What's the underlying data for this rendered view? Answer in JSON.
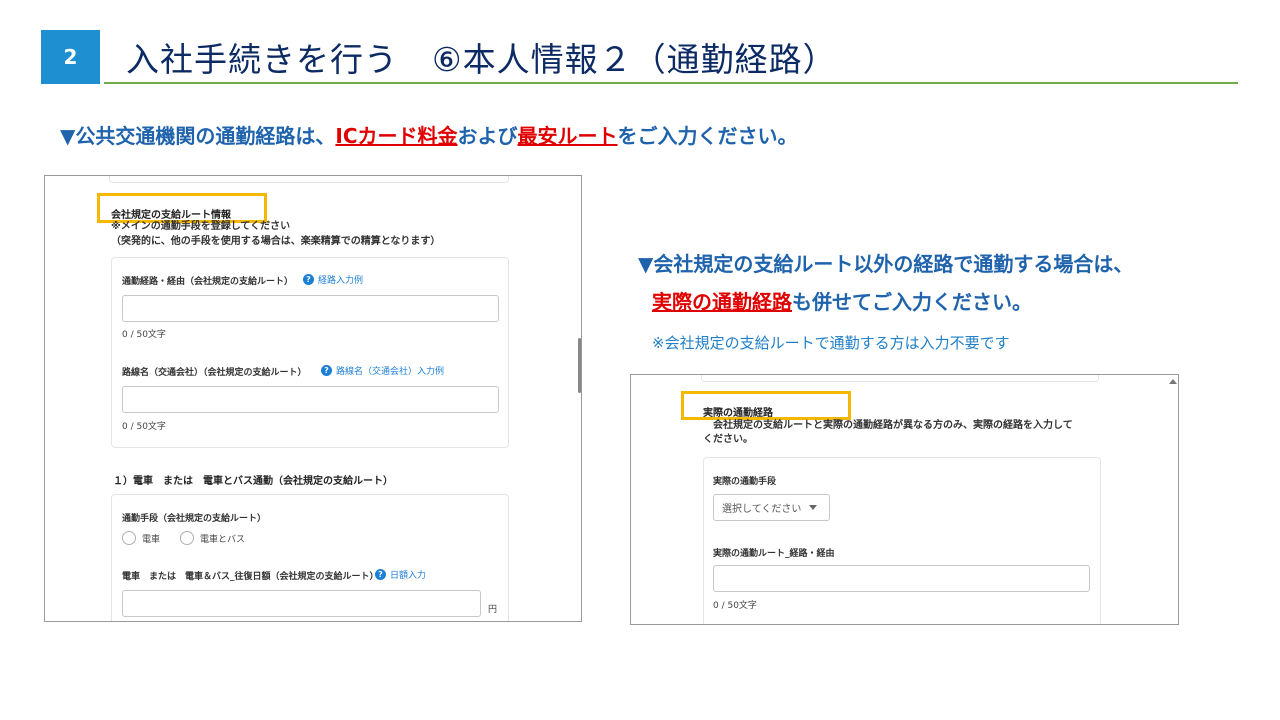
{
  "header": {
    "step_number": "2",
    "title": "入社手続きを行う　⑥本人情報２（通勤経路）"
  },
  "note1": {
    "part1": "▼公共交通機関の通勤経路は、",
    "highlight1": "ICカード料金",
    "part2": "および",
    "highlight2": "最安ルート",
    "part3": "をご入力ください。"
  },
  "note2": {
    "line1": "▼会社規定の支給ルート以外の経路で通勤する場合は、",
    "highlight": "実際の通勤経路",
    "line2_rest": "も併せてご入力ください。",
    "sub": "※会社規定の支給ルートで通勤する方は入力不要です"
  },
  "left_form": {
    "section_title": "会社規定の支給ルート情報",
    "notice1": "※メインの通勤手段を登録してください",
    "notice2": "（突発的に、他の手段を使用する場合は、楽楽精算での精算となります）",
    "route_label": "通勤経路・経由（会社規定の支給ルート）",
    "route_help": "経路入力例",
    "route_count": "0 / 50文字",
    "line_label": "路線名（交通会社）（会社規定の支給ルート）",
    "line_help": "路線名（交通会社）入力例",
    "line_count": "0 / 50文字",
    "subsection_title": "１）電車　または　電車とバス通勤（会社規定の支給ルート）",
    "means_label": "通勤手段（会社規定の支給ルート）",
    "radio_train": "電車",
    "radio_train_bus": "電車とバス",
    "fare_label": "電車　または　電車＆バス_往復日額（会社規定の支給ルート）",
    "fare_help": "日額入力",
    "fare_unit": "円"
  },
  "right_form": {
    "section_title": "実際の通勤経路",
    "notice1": "会社規定の支給ルートと実際の通勤経路が異なる方のみ、実際の経路を入力して",
    "notice2": "ください。",
    "means_label": "実際の通勤手段",
    "select_placeholder": "選択してください",
    "route_label": "実際の通勤ルート_経路・経由",
    "route_count": "0 / 50文字"
  },
  "colors": {
    "badge": "#1e8fd0",
    "title": "#0c2a63",
    "rule": "#70ad47",
    "note_blue": "#1f63ad",
    "note_red": "#e00000",
    "highlight_box": "#f5b800",
    "link": "#1a7fd6"
  }
}
